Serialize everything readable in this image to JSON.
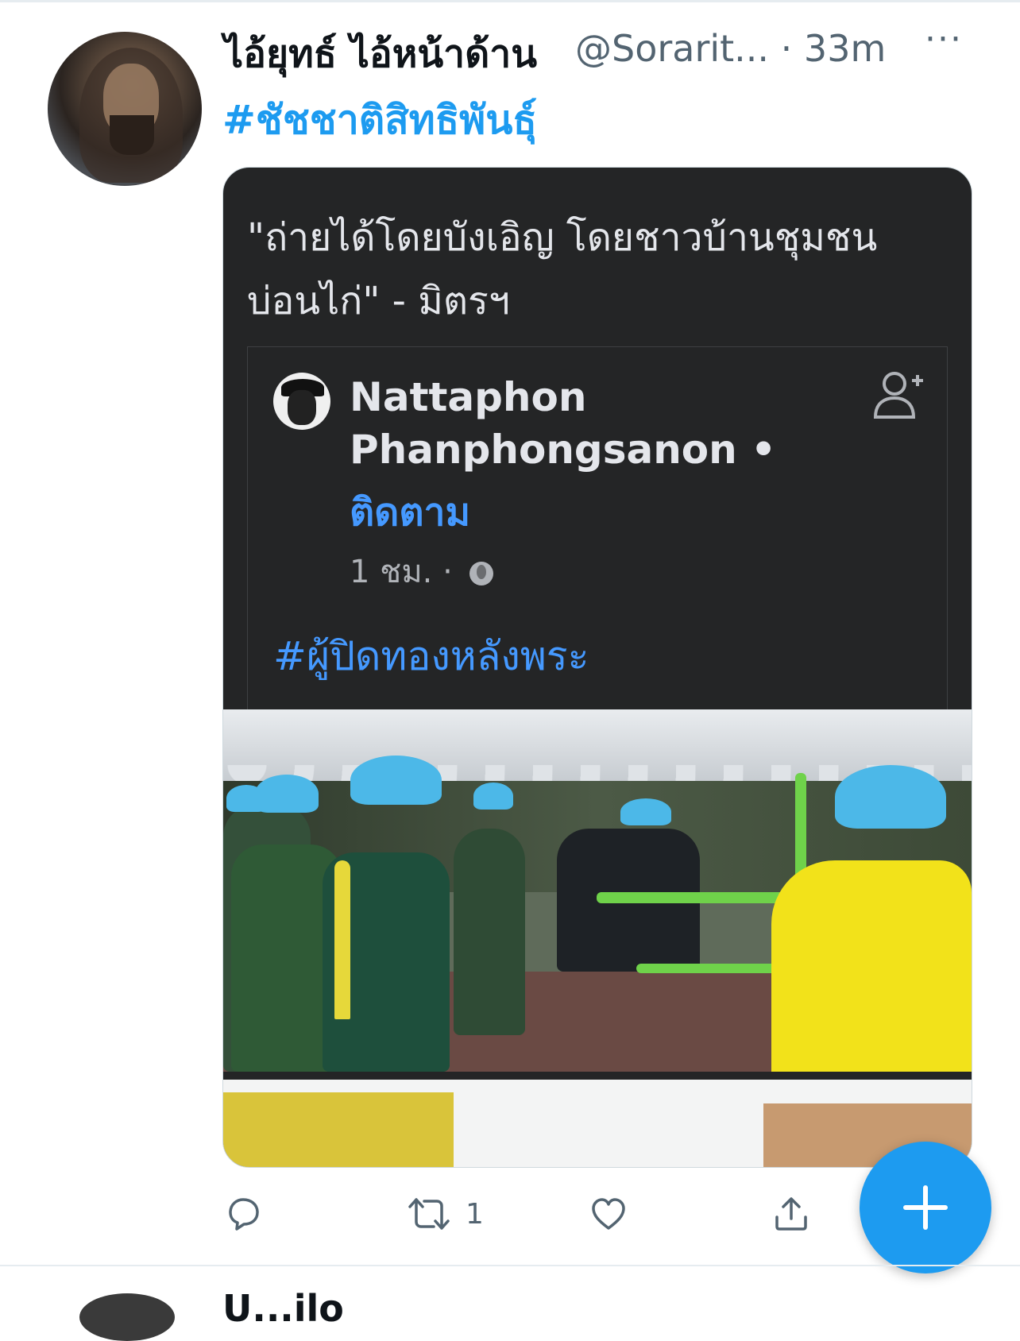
{
  "tweet": {
    "author_name": "ไอ้ยุทธ์ ไอ้หน้าด้าน",
    "handle": "@Sorarit...",
    "separator": "·",
    "time": "33m",
    "more": "···",
    "hashtag": "#ชัชชาติสิทธิพันธุ์",
    "card": {
      "quote": "\"ถ่ายได้โดยบังเอิญ โดยชาวบ้านชุมชนบ่อนไก่\" - มิตรฯ",
      "embed": {
        "author": "Nattaphon Phanphongsanon",
        "dot": "•",
        "follow": "ติดตาม",
        "time": "1 ชม. ·",
        "hashtag": "#ผู้ปิดทองหลังพระ"
      }
    },
    "actions": {
      "reply_count": "",
      "retweet_count": "1",
      "like_count": "",
      "share": ""
    }
  },
  "next_tweet": {
    "name": "U...ilo"
  },
  "colors": {
    "accent": "#1d9bf0",
    "card_bg": "#242526",
    "fb_link": "#4599ff"
  }
}
